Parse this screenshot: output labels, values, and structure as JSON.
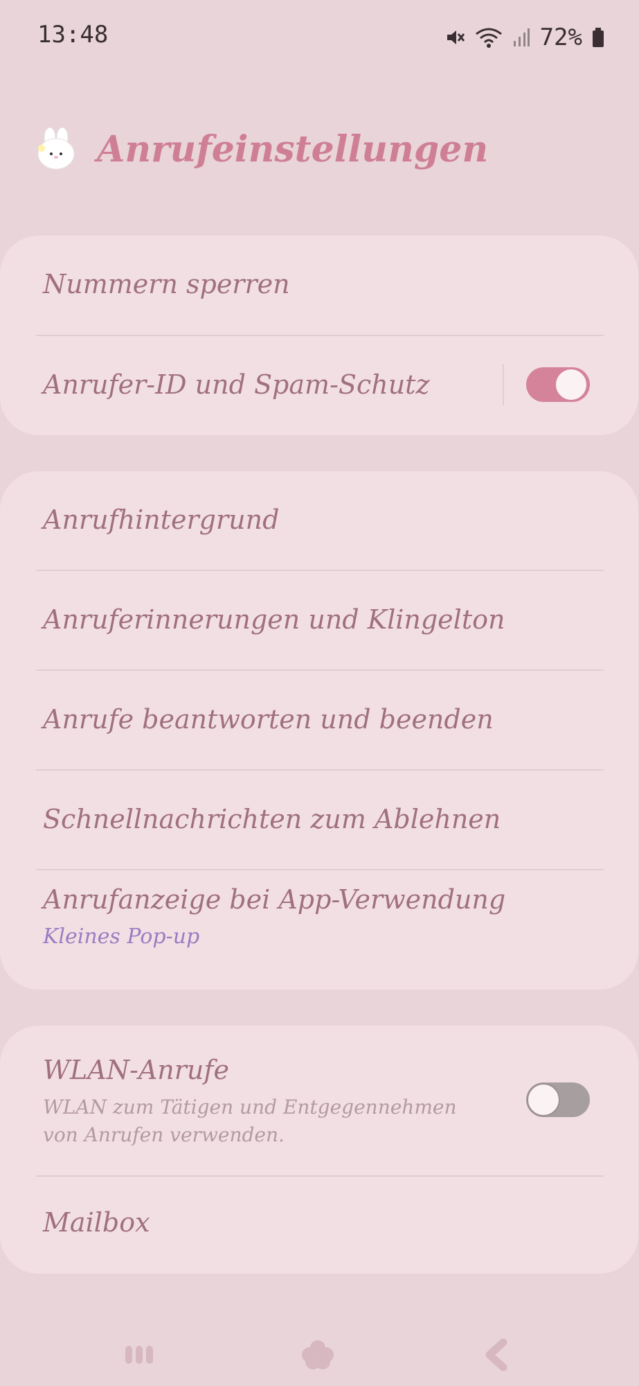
{
  "status_bar": {
    "time": "13:48",
    "battery": "72%",
    "icons": [
      "mute-icon",
      "wifi-icon",
      "signal-icon",
      "battery-icon"
    ]
  },
  "header": {
    "title": "Anrufeinstellungen",
    "avatar_icon": "bunny-avatar-icon"
  },
  "card1": {
    "items": [
      {
        "label": "Nummern sperren"
      },
      {
        "label": "Anrufer-ID und Spam-Schutz",
        "toggle": true
      }
    ]
  },
  "card2": {
    "items": [
      {
        "label": "Anrufhintergrund"
      },
      {
        "label": "Anruferinnerungen und Klingelton"
      },
      {
        "label": "Anrufe beantworten und beenden"
      },
      {
        "label": "Schnellnachrichten zum Ablehnen"
      },
      {
        "label": "Anrufanzeige bei App-Verwendung",
        "sub": "Kleines Pop-up"
      }
    ]
  },
  "card3": {
    "items": [
      {
        "label": "WLAN-Anrufe",
        "desc_line1": "WLAN zum Tätigen und Entgegennehmen",
        "desc_line2": "von Anrufen verwenden.",
        "toggle": false
      },
      {
        "label": "Mailbox"
      }
    ]
  },
  "colors": {
    "accent": "#cf7f95",
    "background": "#e8d4d9",
    "card": "#f2dfe3",
    "toggle_on": "#d4839a",
    "toggle_off": "#a79e9f"
  },
  "navbar": {
    "icons": [
      "recent-apps-icon",
      "home-icon",
      "back-icon"
    ]
  }
}
